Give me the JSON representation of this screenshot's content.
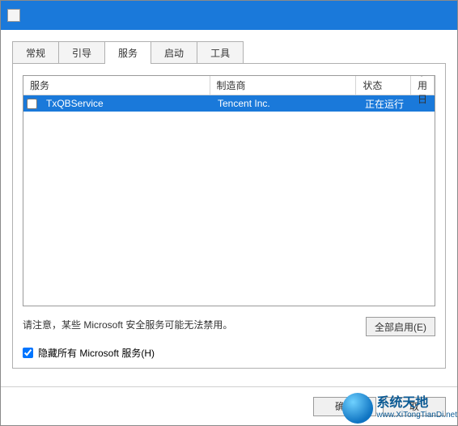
{
  "titlebar": {
    "icon_name": "system-config-icon"
  },
  "tabs": {
    "general": "常规",
    "boot": "引导",
    "services": "服务",
    "startup": "启动",
    "tools": "工具",
    "active": "services"
  },
  "columns": {
    "service": "服务",
    "manufacturer": "制造商",
    "status": "状态",
    "disable_date": "禁用日"
  },
  "rows": [
    {
      "checked": false,
      "service": "TxQBService",
      "manufacturer": "Tencent Inc.",
      "status": "正在运行"
    }
  ],
  "note": "请注意，某些 Microsoft 安全服务可能无法禁用。",
  "buttons": {
    "enable_all": "全部启用(E)",
    "ok": "确定",
    "cancel": "取"
  },
  "hide_ms": {
    "label": "隐藏所有 Microsoft 服务(H)",
    "checked": true
  },
  "watermark": {
    "title": "系统天地",
    "url": "www.XiTongTianDi.net"
  }
}
